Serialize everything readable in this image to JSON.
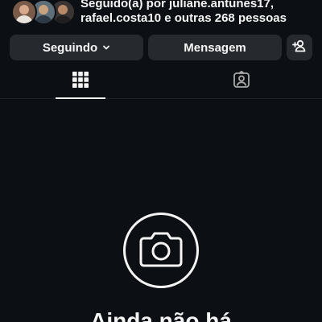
{
  "profile": {
    "followed_by": {
      "line1": "Seguido(a) por juliane.antunes17,",
      "line2": "rafael.costa10 e outras 268 pessoas"
    }
  },
  "actions": {
    "following_label": "Seguindo",
    "message_label": "Mensagem"
  },
  "tabs": [
    {
      "icon": "grid-icon",
      "active": true
    },
    {
      "icon": "tagged-person-icon",
      "active": false
    }
  ],
  "empty_state": {
    "icon": "camera-icon",
    "title": "Ainda não há"
  },
  "colors": {
    "background": "#0c1014",
    "button": "#262a2f",
    "text": "#f5f5f5"
  }
}
